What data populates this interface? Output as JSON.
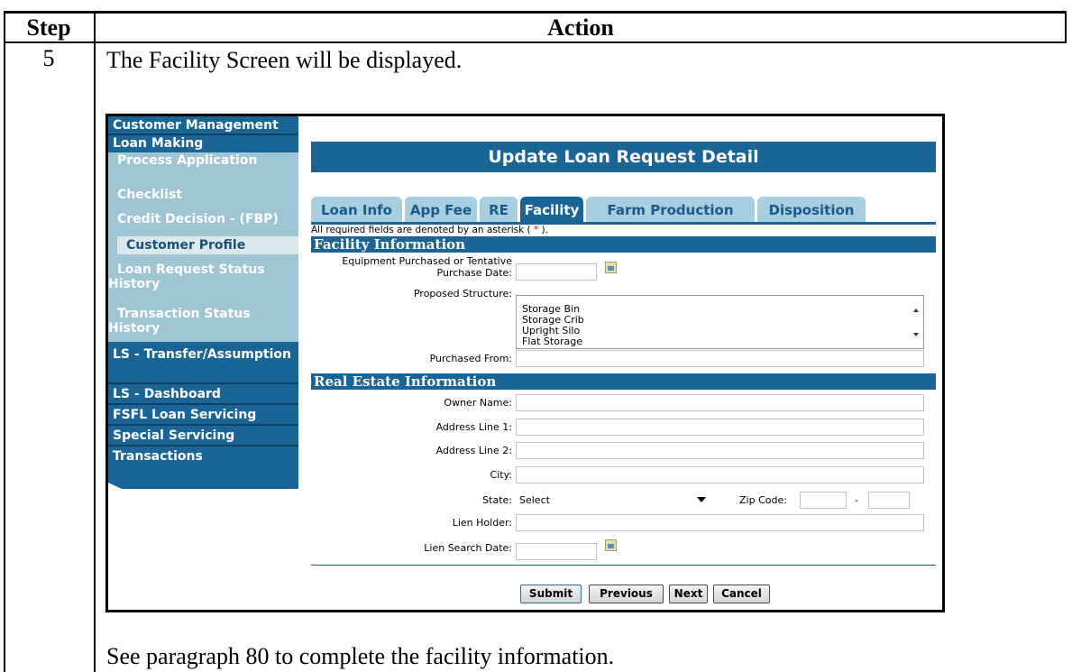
{
  "table": {
    "header_step": "Step",
    "header_action": "Action",
    "step_number": "5",
    "action_text": "The Facility Screen will be displayed.",
    "footer_text": "See paragraph 80 to complete the facility information."
  },
  "nav": {
    "items": [
      {
        "label": "Customer Management"
      },
      {
        "label": "Loan Making"
      },
      {
        "label": "Process Application"
      },
      {
        "label": "Checklist"
      },
      {
        "label": "Credit Decision - (FBP)"
      },
      {
        "label": "Customer Profile"
      },
      {
        "label": "Loan Request Status History"
      },
      {
        "label": "Transaction Status History"
      },
      {
        "label": "LS - Transfer/Assumption"
      },
      {
        "label": "LS - Dashboard"
      },
      {
        "label": "FSFL Loan Servicing"
      },
      {
        "label": "Special Servicing"
      },
      {
        "label": "Transactions"
      }
    ]
  },
  "page_title": "Update Loan Request Detail",
  "tabs": [
    {
      "label": "Loan Info"
    },
    {
      "label": "App Fee"
    },
    {
      "label": "RE"
    },
    {
      "label": "Facility",
      "active": true
    },
    {
      "label": "Farm Production"
    },
    {
      "label": "Disposition"
    }
  ],
  "required_note": {
    "before": "All required fields are denoted by an asterisk ( ",
    "asterisk": "*",
    "after": " )."
  },
  "facility_section": {
    "title": "Facility Information",
    "equipment_label_1": "Equipment Purchased or Tentative",
    "equipment_label_2": "Purchase Date:",
    "proposed_label": "Proposed Structure:",
    "structure_options": [
      "Storage Bin",
      "Storage Crib",
      "Upright Silo",
      "Flat Storage"
    ],
    "purchased_from_label": "Purchased From:"
  },
  "real_estate_section": {
    "title": "Real Estate Information",
    "owner_label": "Owner Name:",
    "address1_label": "Address Line 1:",
    "address2_label": "Address Line 2:",
    "city_label": "City:",
    "state_label": "State:",
    "state_value": "Select",
    "zip_label": "Zip Code:",
    "zip_sep": "-",
    "lien_holder_label": "Lien Holder:",
    "lien_search_label": "Lien Search Date:"
  },
  "buttons": {
    "submit": "Submit",
    "previous": "Previous",
    "next": "Next",
    "cancel": "Cancel"
  },
  "colors": {
    "nav_blue": "#1a6496",
    "nav_sub": "#9fc4d4",
    "tab_inactive": "#a8cfe0"
  }
}
